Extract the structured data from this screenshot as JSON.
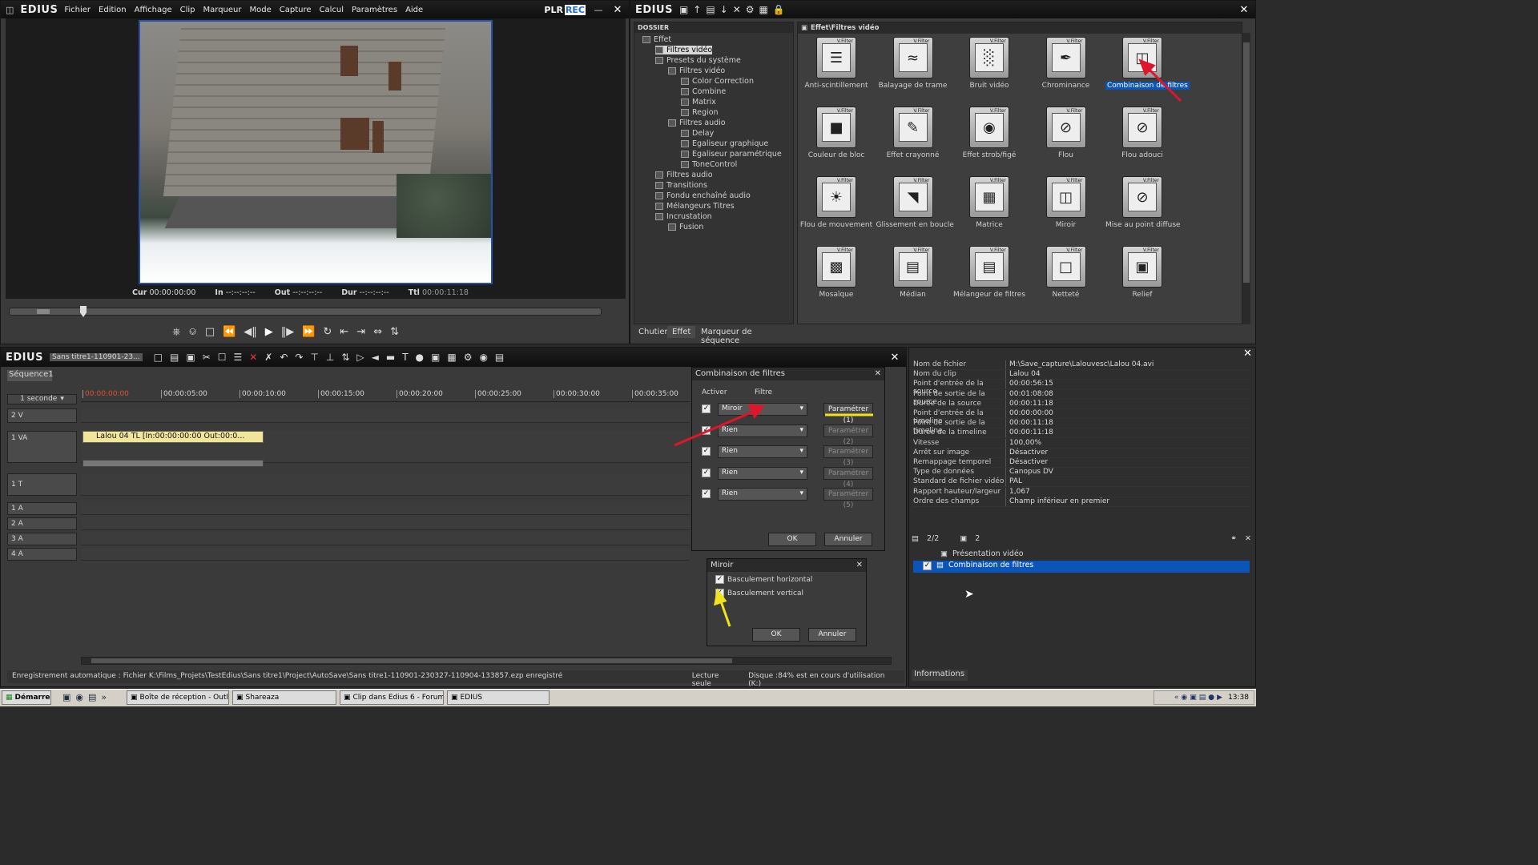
{
  "player": {
    "logo": "EDIUS",
    "menu": [
      "Fichier",
      "Edition",
      "Affichage",
      "Clip",
      "Marqueur",
      "Mode",
      "Capture",
      "Calcul",
      "Paramètres",
      "Aide"
    ],
    "plr": "PLR",
    "rec": "REC",
    "timecodes": {
      "cur_label": "Cur",
      "cur": "00:00:00:00",
      "in_label": "In",
      "in": "--:--:--:--",
      "out_label": "Out",
      "out": "--:--:--:--",
      "dur_label": "Dur",
      "dur": "--:--:--:--",
      "ttl_label": "Ttl",
      "ttl": "00:00:11:18"
    }
  },
  "effects_window": {
    "logo": "EDIUS",
    "folder_header": "DOSSIER",
    "path": "Effet\\Filtres vidéo",
    "tree": [
      {
        "label": "Effet",
        "level": 0
      },
      {
        "label": "Filtres vidéo",
        "level": 1
      },
      {
        "label": "Presets du système",
        "level": 1
      },
      {
        "label": "Filtres vidéo",
        "level": 2
      },
      {
        "label": "Color Correction",
        "level": 3
      },
      {
        "label": "Combine",
        "level": 3
      },
      {
        "label": "Matrix",
        "level": 3
      },
      {
        "label": "Region",
        "level": 3
      },
      {
        "label": "Filtres audio",
        "level": 2
      },
      {
        "label": "Delay",
        "level": 3
      },
      {
        "label": "Egaliseur graphique",
        "level": 3
      },
      {
        "label": "Egaliseur paramétrique",
        "level": 3
      },
      {
        "label": "ToneControl",
        "level": 3
      },
      {
        "label": "Filtres audio",
        "level": 1
      },
      {
        "label": "Transitions",
        "level": 1
      },
      {
        "label": "Fondu enchaîné audio",
        "level": 1
      },
      {
        "label": "Mélangeurs Titres",
        "level": 1
      },
      {
        "label": "Incrustation",
        "level": 1
      },
      {
        "label": "Fusion",
        "level": 2
      }
    ],
    "effects": [
      {
        "label": "Anti-scintillement",
        "icon": "lines-icon"
      },
      {
        "label": "Balayage de trame",
        "icon": "waves-icon"
      },
      {
        "label": "Bruit vidéo",
        "icon": "noise-icon"
      },
      {
        "label": "Chrominance",
        "icon": "eyedropper-icon"
      },
      {
        "label": "Combinaison de filtres",
        "icon": "layers-icon"
      },
      {
        "label": "Couleur de bloc",
        "icon": "black-square-icon"
      },
      {
        "label": "Effet crayonné",
        "icon": "pencil-icon"
      },
      {
        "label": "Effet strob/figé",
        "icon": "camera-icon"
      },
      {
        "label": "Flou",
        "icon": "blur-icon"
      },
      {
        "label": "Flou adouci",
        "icon": "soft-blur-icon"
      },
      {
        "label": "Flou de mouvement",
        "icon": "motion-blur-icon"
      },
      {
        "label": "Glissement en boucle",
        "icon": "loop-slide-icon"
      },
      {
        "label": "Matrice",
        "icon": "grid-icon"
      },
      {
        "label": "Miroir",
        "icon": "mirror-icon"
      },
      {
        "label": "Mise au point diffuse",
        "icon": "diffuse-focus-icon"
      },
      {
        "label": "Mosaïque",
        "icon": "mosaic-icon"
      },
      {
        "label": "Médian",
        "icon": "median-icon"
      },
      {
        "label": "Mélangeur de filtres",
        "icon": "mixer-icon"
      },
      {
        "label": "Netteté",
        "icon": "sharpen-icon"
      },
      {
        "label": "Relief",
        "icon": "emboss-icon"
      }
    ],
    "thumb_tag": "V.Filter",
    "tabs": [
      "Chutier",
      "Effet",
      "Marqueur de séquence"
    ]
  },
  "timeline": {
    "logo": "EDIUS",
    "project_name": "Sans titre1-110901-23...",
    "sequence_tab": "Séquence1",
    "scale": "1 seconde",
    "ruler": [
      "00:00:00:00",
      "00:00:05:00",
      "00:00:10:00",
      "00:00:15:00",
      "00:00:20:00",
      "00:00:25:00",
      "00:00:30:00",
      "00:00:35:00"
    ],
    "tracks": [
      "2 V",
      "1 VA",
      "1 T",
      "1 A",
      "2 A",
      "3 A",
      "4 A"
    ],
    "clip_label": "Lalou 04  TL [In:00:00:00:00 Out:00:0..."
  },
  "combo_dialog": {
    "title": "Combinaison de filtres",
    "col_activer": "Activer",
    "col_filtre": "Filtre",
    "rows": [
      {
        "filter": "Miroir",
        "button": "Paramétrer (1)"
      },
      {
        "filter": "Rien",
        "button": "Paramétrer (2)"
      },
      {
        "filter": "Rien",
        "button": "Paramétrer (3)"
      },
      {
        "filter": "Rien",
        "button": "Paramétrer (4)"
      },
      {
        "filter": "Rien",
        "button": "Paramétrer (5)"
      }
    ],
    "ok": "OK",
    "cancel": "Annuler"
  },
  "mirror_dialog": {
    "title": "Miroir",
    "horizontal": "Basculement horizontal",
    "vertical": "Basculement vertical",
    "ok": "OK",
    "cancel": "Annuler"
  },
  "info_panel": {
    "rows": [
      {
        "k": "Nom de fichier",
        "v": "M:\\Save_capture\\Lalouvesc\\Lalou 04.avi"
      },
      {
        "k": "Nom du clip",
        "v": "Lalou 04"
      },
      {
        "k": "Point d'entrée de la source",
        "v": "00:00:56:15"
      },
      {
        "k": "Point de sortie de la source",
        "v": "00:01:08:08"
      },
      {
        "k": "Durée de la source",
        "v": "00:00:11:18"
      },
      {
        "k": "Point d'entrée de la timeline",
        "v": "00:00:00:00"
      },
      {
        "k": "Point de sortie de la timeline",
        "v": "00:00:11:18"
      },
      {
        "k": "Durée de la timeline",
        "v": "00:00:11:18"
      },
      {
        "k": "Vitesse",
        "v": "100,00%"
      },
      {
        "k": "Arrêt sur image",
        "v": "Désactiver"
      },
      {
        "k": "Remappage temporel",
        "v": "Désactiver"
      },
      {
        "k": "Type de données",
        "v": "Canopus DV"
      },
      {
        "k": "Standard de fichier vidéo",
        "v": "PAL"
      },
      {
        "k": "Rapport hauteur/largeur",
        "v": "1,067"
      },
      {
        "k": "Ordre des champs",
        "v": "Champ inférieur en premier"
      }
    ],
    "page": "2/2",
    "count": "2",
    "layers": [
      "Présentation vidéo",
      "Combinaison de filtres"
    ],
    "tab": "Informations"
  },
  "status_bar": {
    "message": "Enregistrement automatique : Fichier K:\\Films_Projets\\TestEdius\\Sans titre1\\Project\\AutoSave\\Sans titre1-110901-230327-110904-133857.ezp enregistré",
    "readonly": "Lecture seule",
    "disk": "Disque :84% est en cours d'utilisation (K:)"
  },
  "taskbar": {
    "start": "Démarrer",
    "items": [
      "Boîte de réception - Outl...",
      "Shareaza",
      "Clip dans Edius 6 - Forum...",
      "EDIUS"
    ],
    "clock": "13:38"
  },
  "colors": {
    "accent": "#0c55b8",
    "annotation_red": "#e0152b",
    "annotation_yellow": "#f2e21b"
  }
}
